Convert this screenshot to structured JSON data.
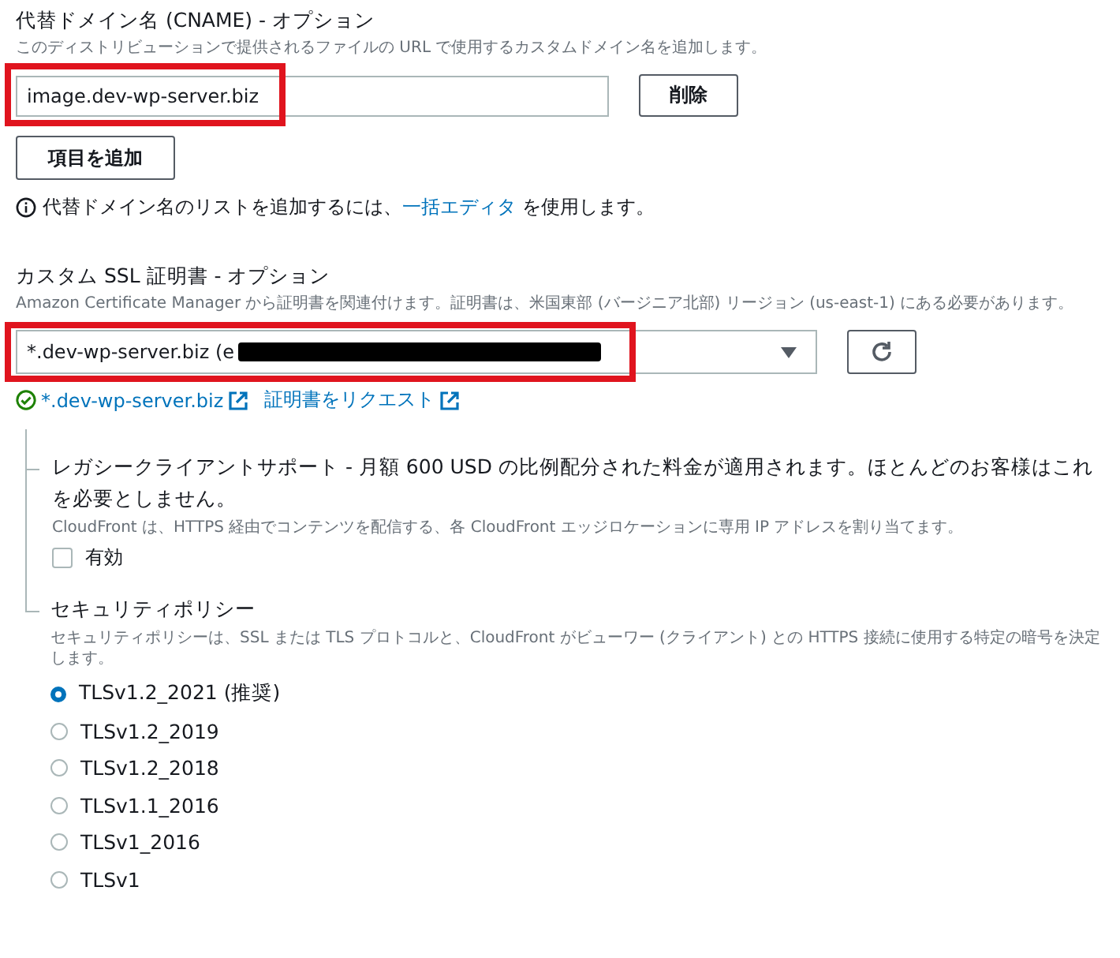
{
  "cname": {
    "title": "代替ドメイン名 (CNAME) - オプション",
    "description": "このディストリビューションで提供されるファイルの URL で使用するカスタムドメイン名を追加します。",
    "items": [
      {
        "value": "image.dev-wp-server.biz",
        "highlighted": true
      }
    ],
    "remove_button": "削除",
    "add_button": "項目を追加",
    "info": {
      "before": "代替ドメイン名のリストを追加するには、",
      "link": "一括エディタ",
      "after": " を使用します。"
    }
  },
  "certificate": {
    "title": "カスタム SSL 証明書 - オプション",
    "description": "Amazon Certificate Manager から証明書を関連付けます。証明書は、米国東部 (バージニア北部) リージョン (us-east-1) にある必要があります。",
    "value": "*.dev-wp-server.biz (e",
    "highlighted": true,
    "redacted": true,
    "links": [
      "*.dev-wp-server.biz",
      "証明書をリクエスト"
    ]
  },
  "legacy": {
    "title": "レガシークライアントサポート - 月額 600 USD の比例配分された料金が適用されます。ほとんどのお客様はこれを必要としません。",
    "description": "CloudFront は、HTTPS 経由でコンテンツを配信する、各 CloudFront エッジロケーションに専用 IP アドレスを割り当てます。",
    "checkbox": {
      "label": "有効",
      "checked": false
    }
  },
  "security_policy": {
    "title": "セキュリティポリシー",
    "description": "セキュリティポリシーは、SSL または TLS プロトコルと、CloudFront がビューワー (クライアント) との HTTPS 接続に使用する特定の暗号を決定します。",
    "options": [
      {
        "label": "TLSv1.2_2021 (推奨)",
        "selected": true
      },
      {
        "label": "TLSv1.2_2019",
        "selected": false
      },
      {
        "label": "TLSv1.2_2018",
        "selected": false
      },
      {
        "label": "TLSv1.1_2016",
        "selected": false
      },
      {
        "label": "TLSv1_2016",
        "selected": false
      },
      {
        "label": "TLSv1",
        "selected": false
      }
    ]
  }
}
